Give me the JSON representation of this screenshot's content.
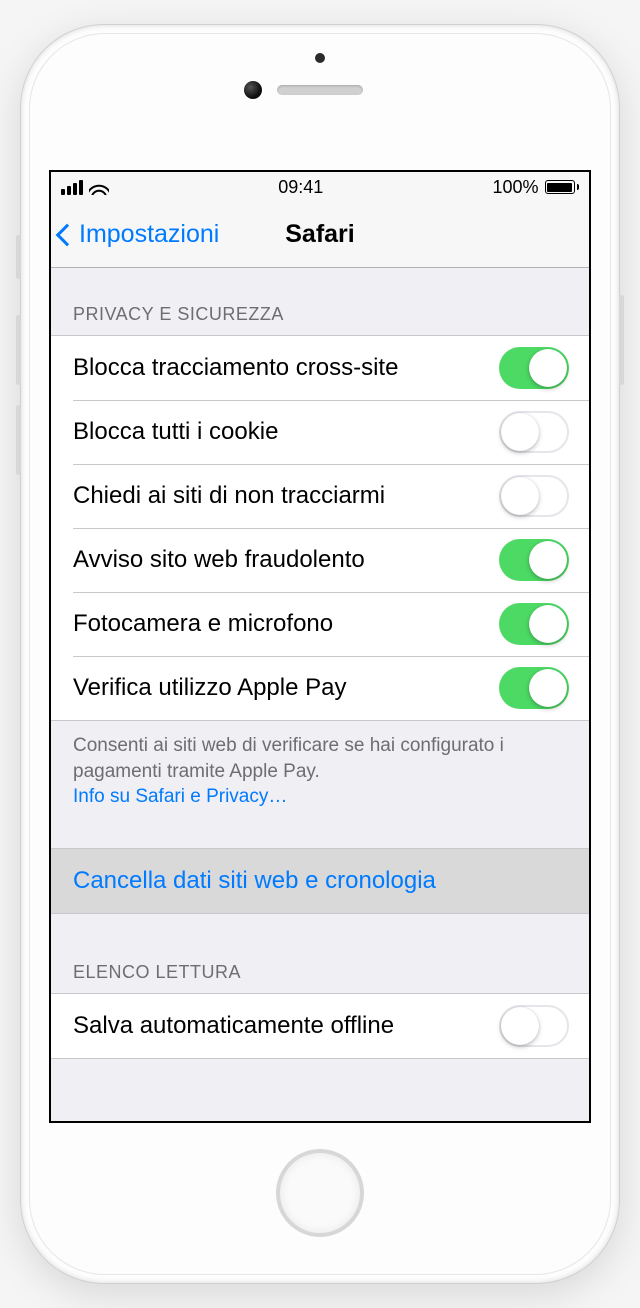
{
  "status": {
    "time": "09:41",
    "battery_pct": "100%"
  },
  "nav": {
    "back_label": "Impostazioni",
    "title": "Safari"
  },
  "sections": {
    "privacy": {
      "header": "PRIVACY E SICUREZZA",
      "items": {
        "cross_site": {
          "label": "Blocca tracciamento cross-site",
          "on": true
        },
        "block_cookies": {
          "label": "Blocca tutti i cookie",
          "on": false
        },
        "do_not_track": {
          "label": "Chiedi ai siti di non tracciarmi",
          "on": false
        },
        "fraud_warn": {
          "label": "Avviso sito web fraudolento",
          "on": true
        },
        "camera_mic": {
          "label": "Fotocamera e microfono",
          "on": true
        },
        "apple_pay": {
          "label": "Verifica utilizzo Apple Pay",
          "on": true
        }
      },
      "footer_text": "Consenti ai siti web di verificare se hai configurato i pagamenti tramite Apple Pay.",
      "footer_link": "Info su Safari e Privacy…"
    },
    "clear": {
      "label": "Cancella dati siti web e cronologia"
    },
    "reading_list": {
      "header": "ELENCO LETTURA",
      "items": {
        "save_offline": {
          "label": "Salva automaticamente offline",
          "on": false
        }
      }
    }
  }
}
